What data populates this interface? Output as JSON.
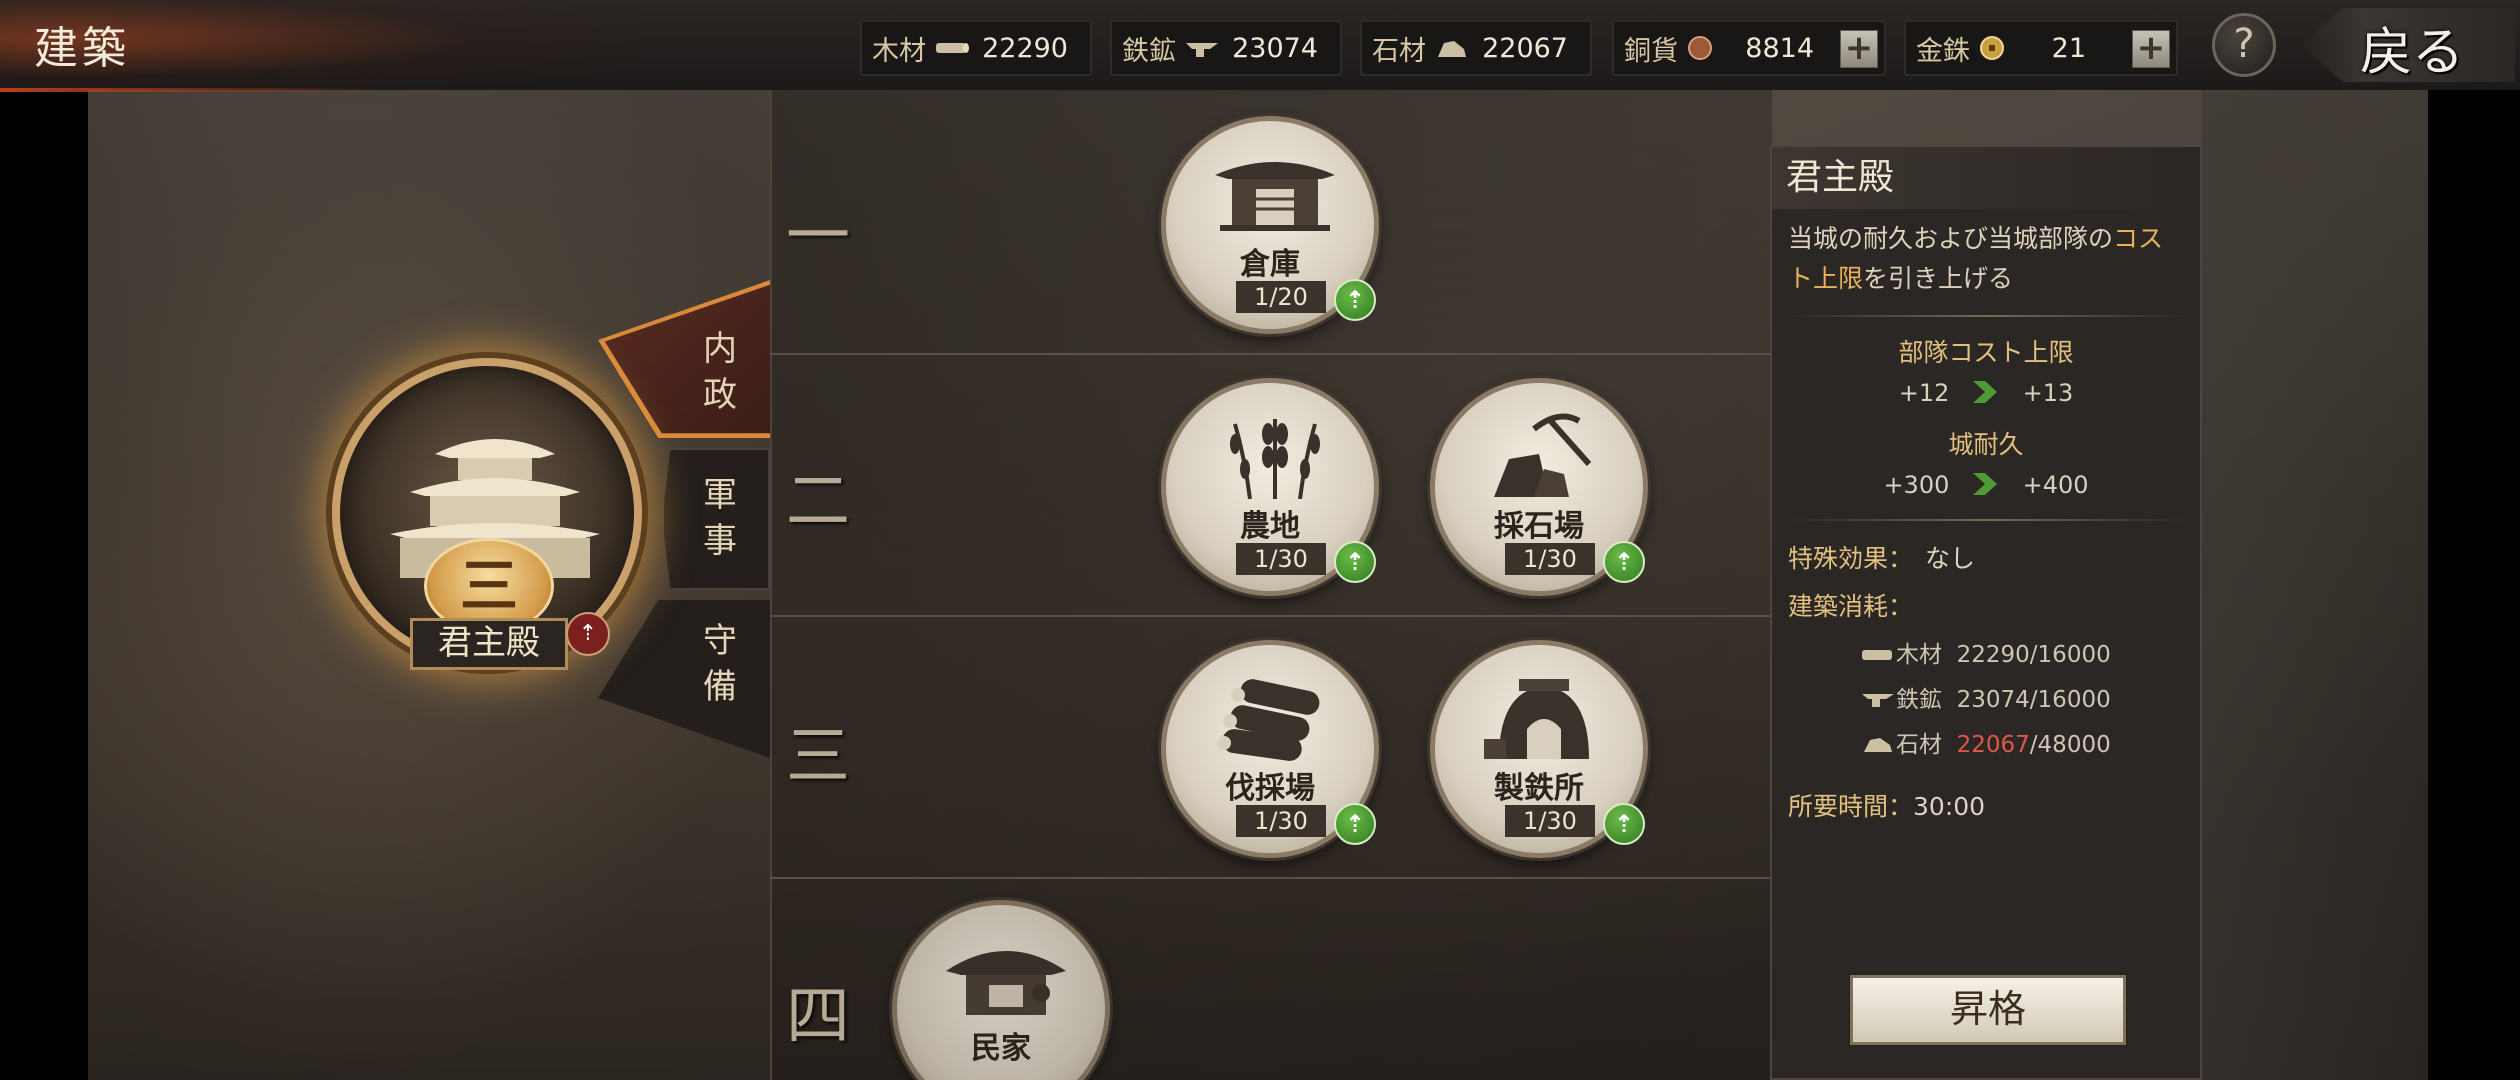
{
  "header": {
    "title": "建築",
    "back_label": "戻る",
    "help_label": "?"
  },
  "resources": [
    {
      "name": "木材",
      "icon": "wood-icon",
      "value": "22290"
    },
    {
      "name": "鉄鉱",
      "icon": "iron-icon",
      "value": "23074"
    },
    {
      "name": "石材",
      "icon": "stone-icon",
      "value": "22067"
    },
    {
      "name": "銅貨",
      "icon": "copper-coin-icon",
      "value": "8814"
    },
    {
      "name": "金銖",
      "icon": "gold-coin-icon",
      "value": "21"
    }
  ],
  "castle": {
    "name": "君主殿",
    "level": "三"
  },
  "tabs": [
    {
      "label": "内政",
      "active": true
    },
    {
      "label": "軍事",
      "active": false
    },
    {
      "label": "守備",
      "active": false
    }
  ],
  "tiers": [
    "一",
    "二",
    "三",
    "四"
  ],
  "buildings": [
    {
      "name": "倉庫",
      "count": "1/20"
    },
    {
      "name": "農地",
      "count": "1/30"
    },
    {
      "name": "採石場",
      "count": "1/30"
    },
    {
      "name": "伐採場",
      "count": "1/30"
    },
    {
      "name": "製鉄所",
      "count": "1/30"
    },
    {
      "name": "民家"
    }
  ],
  "info": {
    "title": "君主殿",
    "desc_pre": "当城の耐久および当城部隊の",
    "desc_hl": "コスト上限",
    "desc_post": "を引き上げる",
    "stats": [
      {
        "label": "部隊コスト上限",
        "from": "+12",
        "to": "+13"
      },
      {
        "label": "城耐久",
        "from": "+300",
        "to": "+400"
      }
    ],
    "special_label": "特殊効果：",
    "special_value": "なし",
    "cost_label": "建築消耗：",
    "costs": [
      {
        "name": "木材",
        "have": "22290",
        "need": "/16000",
        "insufficient": false
      },
      {
        "name": "鉄鉱",
        "have": "23074",
        "need": "/16000",
        "insufficient": false
      },
      {
        "name": "石材",
        "have": "22067",
        "need": "/48000",
        "insufficient": true
      }
    ],
    "time_label": "所要時間：",
    "time_value": "30:00",
    "promote_label": "昇格"
  },
  "colors": {
    "accent_gold": "#e2c07e",
    "upgrade_green": "#3f8f2a",
    "insufficient_red": "#e0574a"
  }
}
